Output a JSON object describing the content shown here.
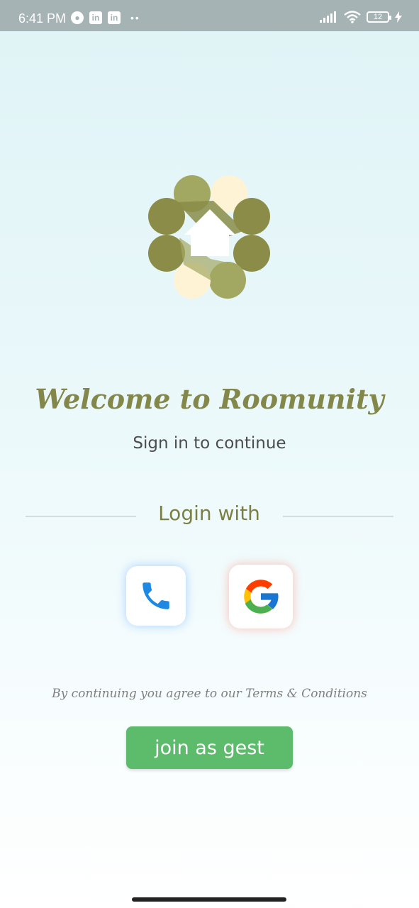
{
  "status_bar": {
    "time": "6:41 PM",
    "battery": "12",
    "left_icons": [
      "app-icon",
      "linkedin-icon",
      "linkedin-icon"
    ],
    "right_icons": [
      "signal-icon",
      "wifi-icon",
      "battery-icon",
      "charging-icon"
    ]
  },
  "welcome": {
    "title": "Welcome to Roomunity",
    "subtitle": "Sign in to continue"
  },
  "login": {
    "label": "Login with",
    "options": [
      "phone-icon",
      "google-icon"
    ]
  },
  "terms": "By continuing you agree to our Terms & Conditions",
  "guest_button": "join as gest",
  "colors": {
    "accent": "#84874a",
    "guest_button": "#5dbb6c",
    "status_bar": "#a5b3b5"
  }
}
